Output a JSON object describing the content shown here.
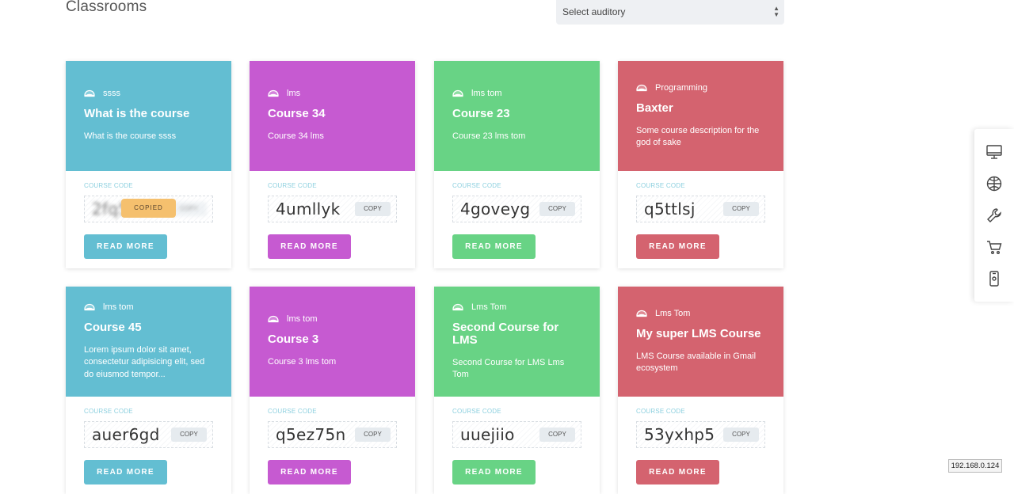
{
  "page": {
    "title": "Classrooms"
  },
  "filter": {
    "auditory_select": "Select auditory"
  },
  "copy_label": "COPY",
  "copied_label": "COPIED",
  "code_label": "COURSE CODE",
  "read_more_label": "READ MORE",
  "colors": {
    "blue": "#63bed2",
    "purple": "#c65ad1",
    "green": "#68d385",
    "red": "#d4636f"
  },
  "cards": [
    {
      "auditory": "ssss",
      "title": "What is the course",
      "description": "What is the course ssss",
      "code": "2fq5",
      "copied": true,
      "color": "#63bed2"
    },
    {
      "auditory": "lms",
      "title": "Course 34",
      "description": "Course 34 lms",
      "code": "4umllyk",
      "copied": false,
      "color": "#c65ad1"
    },
    {
      "auditory": "lms tom",
      "title": "Course 23",
      "description": "Course 23 lms tom",
      "code": "4goveyg",
      "copied": false,
      "color": "#68d385"
    },
    {
      "auditory": "Programming",
      "title": "Baxter",
      "description": "Some course description for the god of sake",
      "code": "q5ttlsj",
      "copied": false,
      "color": "#d4636f"
    },
    {
      "auditory": "lms tom",
      "title": "Course 45",
      "description": "Lorem ipsum dolor sit amet, consectetur adipisicing elit, sed do eiusmod tempor...",
      "code": "auer6gd",
      "copied": false,
      "color": "#63bed2"
    },
    {
      "auditory": "lms tom",
      "title": "Course 3",
      "description": "Course 3 lms tom",
      "code": "q5ez75n",
      "copied": false,
      "color": "#c65ad1"
    },
    {
      "auditory": "Lms Tom",
      "title": "Second Course for LMS",
      "description": "Second Course for LMS Lms Tom",
      "code": "uuejiio",
      "copied": false,
      "color": "#68d385"
    },
    {
      "auditory": "Lms Tom",
      "title": "My super LMS Course",
      "description": "LMS Course available in Gmail ecosystem",
      "code": "53yxhp5",
      "copied": false,
      "color": "#d4636f"
    }
  ],
  "side_tools": [
    "monitor-icon",
    "globe-icon",
    "wrench-icon",
    "cart-icon",
    "mobile-icon"
  ],
  "ip_address": "192.168.0.124"
}
